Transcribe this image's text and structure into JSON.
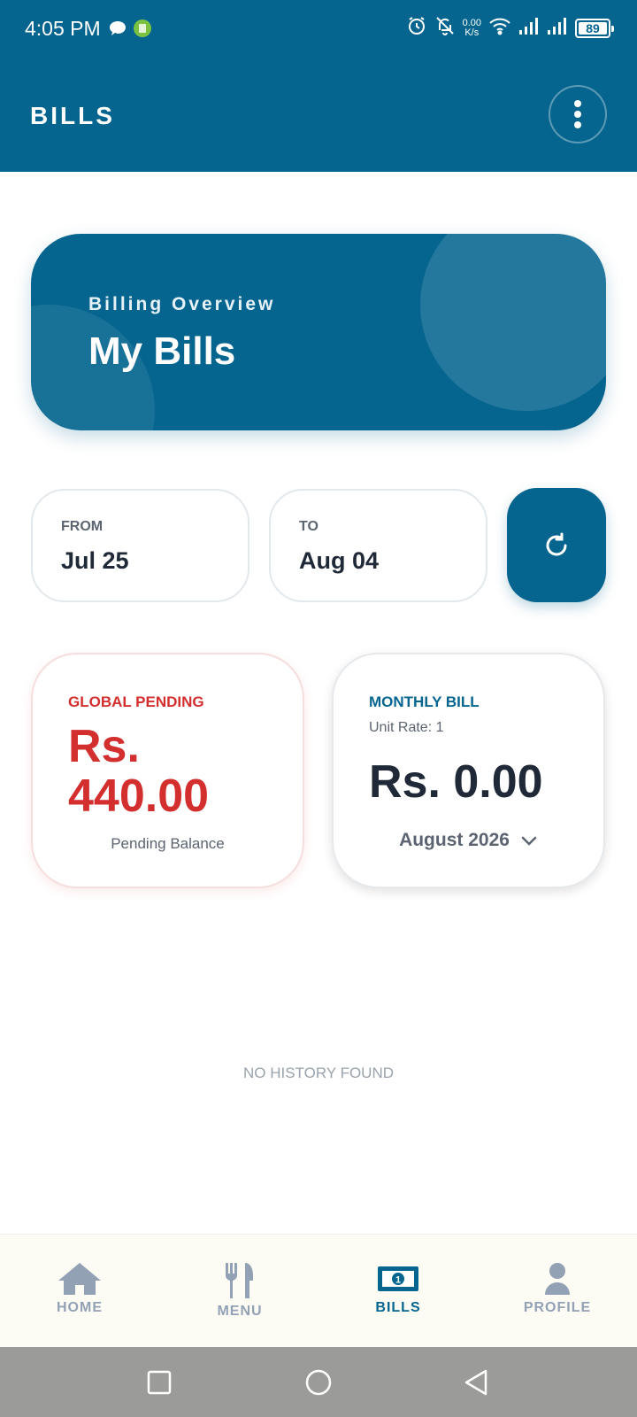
{
  "status_bar": {
    "time": "4:05 PM",
    "network_speed_value": "0.00",
    "network_speed_unit": "K/s",
    "battery": "89",
    "icons": [
      "chat-icon",
      "app-badge-icon",
      "alarm-icon",
      "bell-off-icon",
      "wifi-icon",
      "signal-icon",
      "signal-icon",
      "battery-icon"
    ]
  },
  "app_bar": {
    "title": "BILLS",
    "menu_icon": "more-vert-icon"
  },
  "hero": {
    "subtitle": "Billing Overview",
    "title": "My Bills"
  },
  "date_range": {
    "from_label": "FROM",
    "from_value": "Jul 25",
    "to_label": "TO",
    "to_value": "Aug 04",
    "refresh_icon": "refresh-icon"
  },
  "global_pending": {
    "label": "GLOBAL PENDING",
    "amount": "Rs. 440.00",
    "caption": "Pending Balance"
  },
  "monthly_bill": {
    "label": "MONTHLY BILL",
    "unit_rate": "Unit Rate: 1",
    "amount": "Rs. 0.00",
    "month": "August 2026",
    "dropdown_icon": "chevron-down-icon"
  },
  "history": {
    "empty_text": "NO HISTORY FOUND"
  },
  "bottom_nav": {
    "items": [
      {
        "label": "HOME",
        "icon": "home-icon",
        "active": false
      },
      {
        "label": "MENU",
        "icon": "utensils-icon",
        "active": false
      },
      {
        "label": "BILLS",
        "icon": "money-bill-icon",
        "active": true
      },
      {
        "label": "PROFILE",
        "icon": "user-icon",
        "active": false
      }
    ]
  },
  "colors": {
    "primary": "#05658f",
    "danger": "#d32f2f",
    "text_dark": "#1f2937",
    "muted": "#5b6470",
    "nav_inactive": "#93a1b5"
  }
}
